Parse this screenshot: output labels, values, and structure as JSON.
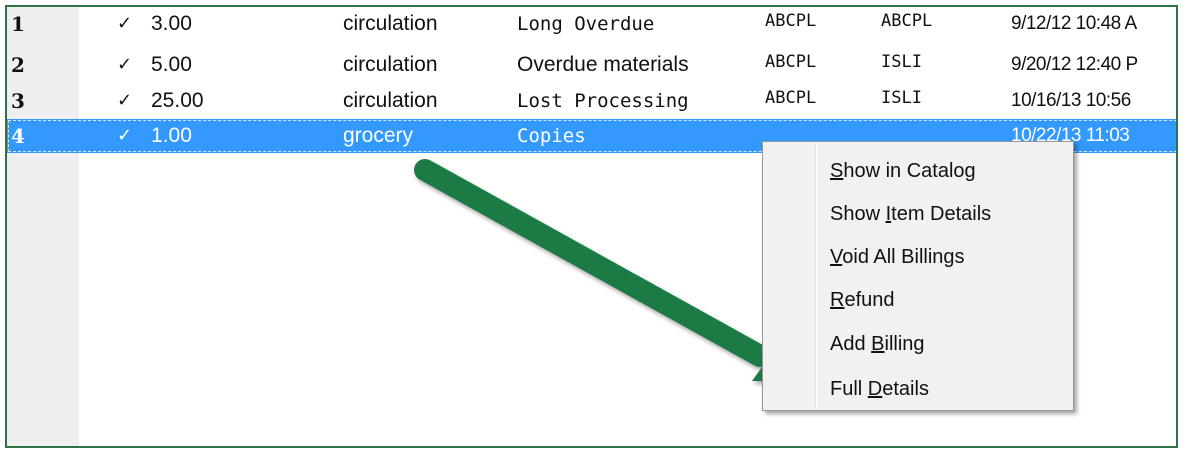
{
  "rows": [
    {
      "num": "1",
      "check": "✓",
      "amount": "3.00",
      "type": "circulation",
      "note": "Long Overdue",
      "lib1": "ABCPL",
      "lib2": "ABCPL",
      "date": "9/12/12 10:48 A"
    },
    {
      "num": "2",
      "check": "✓",
      "amount": "5.00",
      "type": "circulation",
      "note": "Overdue materials",
      "lib1": "ABCPL",
      "lib2": "ISLI",
      "date": "9/20/12 12:40 P"
    },
    {
      "num": "3",
      "check": "✓",
      "amount": "25.00",
      "type": "circulation",
      "note": "Lost Processing",
      "lib1": "ABCPL",
      "lib2": "ISLI",
      "date": "10/16/13 10:56"
    },
    {
      "num": "4",
      "check": "✓",
      "amount": "1.00",
      "type": "grocery",
      "note": "Copies",
      "lib1": "",
      "lib2": "",
      "date": "10/22/13 11:03"
    }
  ],
  "context_menu": {
    "items": [
      {
        "pre": "",
        "key": "S",
        "post": "how in Catalog"
      },
      {
        "pre": "Show ",
        "key": "I",
        "post": "tem Details"
      },
      {
        "pre": "",
        "key": "V",
        "post": "oid All Billings"
      },
      {
        "pre": "",
        "key": "R",
        "post": "efund"
      },
      {
        "pre": "Add ",
        "key": "B",
        "post": "illing"
      },
      {
        "pre": "Full ",
        "key": "D",
        "post": "etails"
      }
    ]
  },
  "colors": {
    "selection": "#3399ff",
    "frame_border": "#2e7346",
    "arrow": "#1f7a45"
  }
}
